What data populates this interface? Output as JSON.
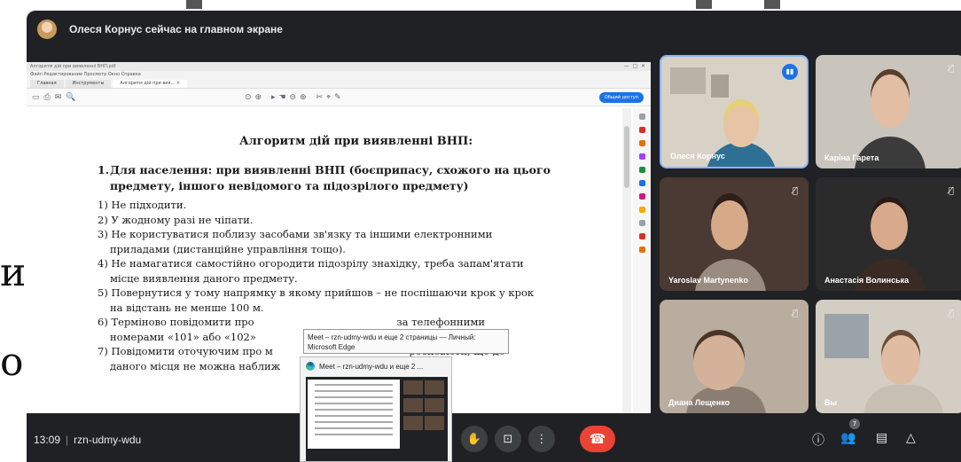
{
  "slide": {
    "left_chars": [
      "и",
      "о"
    ]
  },
  "banner": {
    "presenter_text": "Олеся Корнус сейчас на главном экране"
  },
  "app_window": {
    "title": "Алгоритм дій при виявленні ВНП.pdf",
    "menu": "Файл  Редактирование  Просмотр  Окно  Справка",
    "tabs": [
      "Главная",
      "Инструменты",
      "Алгоритм дій при вия... ×"
    ],
    "share_button": "Общий доступ"
  },
  "document": {
    "heading": "Алгоритм дій при виявленні ВНП:",
    "section_number": "1.",
    "section_title_line1": "Для населення: при виявленні ВНП (боєприпасу, схожого на цього",
    "section_title_line2": "предмету, іншого невідомого та підозрілого предмету)",
    "items": [
      {
        "n": "1)",
        "l1": "Не підходити.",
        "l2": ""
      },
      {
        "n": "2)",
        "l1": "У жодному разі не чіпати.",
        "l2": ""
      },
      {
        "n": "3)",
        "l1": "Не користуватися поблизу засобами зв'язку та іншими електронними",
        "l2": "приладами (дистанційне управління тощо)."
      },
      {
        "n": "4)",
        "l1": "Не намагатися самостійно огородити підозрілу знахідку, треба запам'ятати",
        "l2": "місце виявлення даного предмету."
      },
      {
        "n": "5)",
        "l1": "Повернутися у тому напрямку в якому прийшов – не поспішаючи крок у крок",
        "l2": "на відстань не менше 100 м."
      },
      {
        "n": "6)",
        "l1": "Терміново повідомити про                                            за телефонними",
        "l2": "номерами «101» або «102»"
      },
      {
        "n": "7)",
        "l1": "Повідомити оточуючим про м                                          розповісти, що до",
        "l2": "даного місця не можна наближ"
      }
    ]
  },
  "tooltip": {
    "line1": "Meet – rzn-udmy-wdu и еще 2 страницы — Личный:",
    "line2": "Microsoft Edge"
  },
  "thumbnail": {
    "title": "Meet – rzn-udmy-wdu и еще 2 ..."
  },
  "participants": [
    {
      "name": "Олеся Корнус",
      "speaking": true
    },
    {
      "name": "Каріна Гарета"
    },
    {
      "name": "Yaroslav Martynenko"
    },
    {
      "name": "Анастасія Волинська"
    },
    {
      "name": "Диана Лещенко"
    },
    {
      "name": "Вы"
    }
  ],
  "bottom_bar": {
    "time": "13:09",
    "meeting_code": "rzn-udmy-wdu",
    "participant_count": "7"
  },
  "colors": {
    "meet_bg": "#202124",
    "tile_bg": "#3c4043",
    "end_call": "#ea4335",
    "speaking_accent": "#1a73e8"
  }
}
